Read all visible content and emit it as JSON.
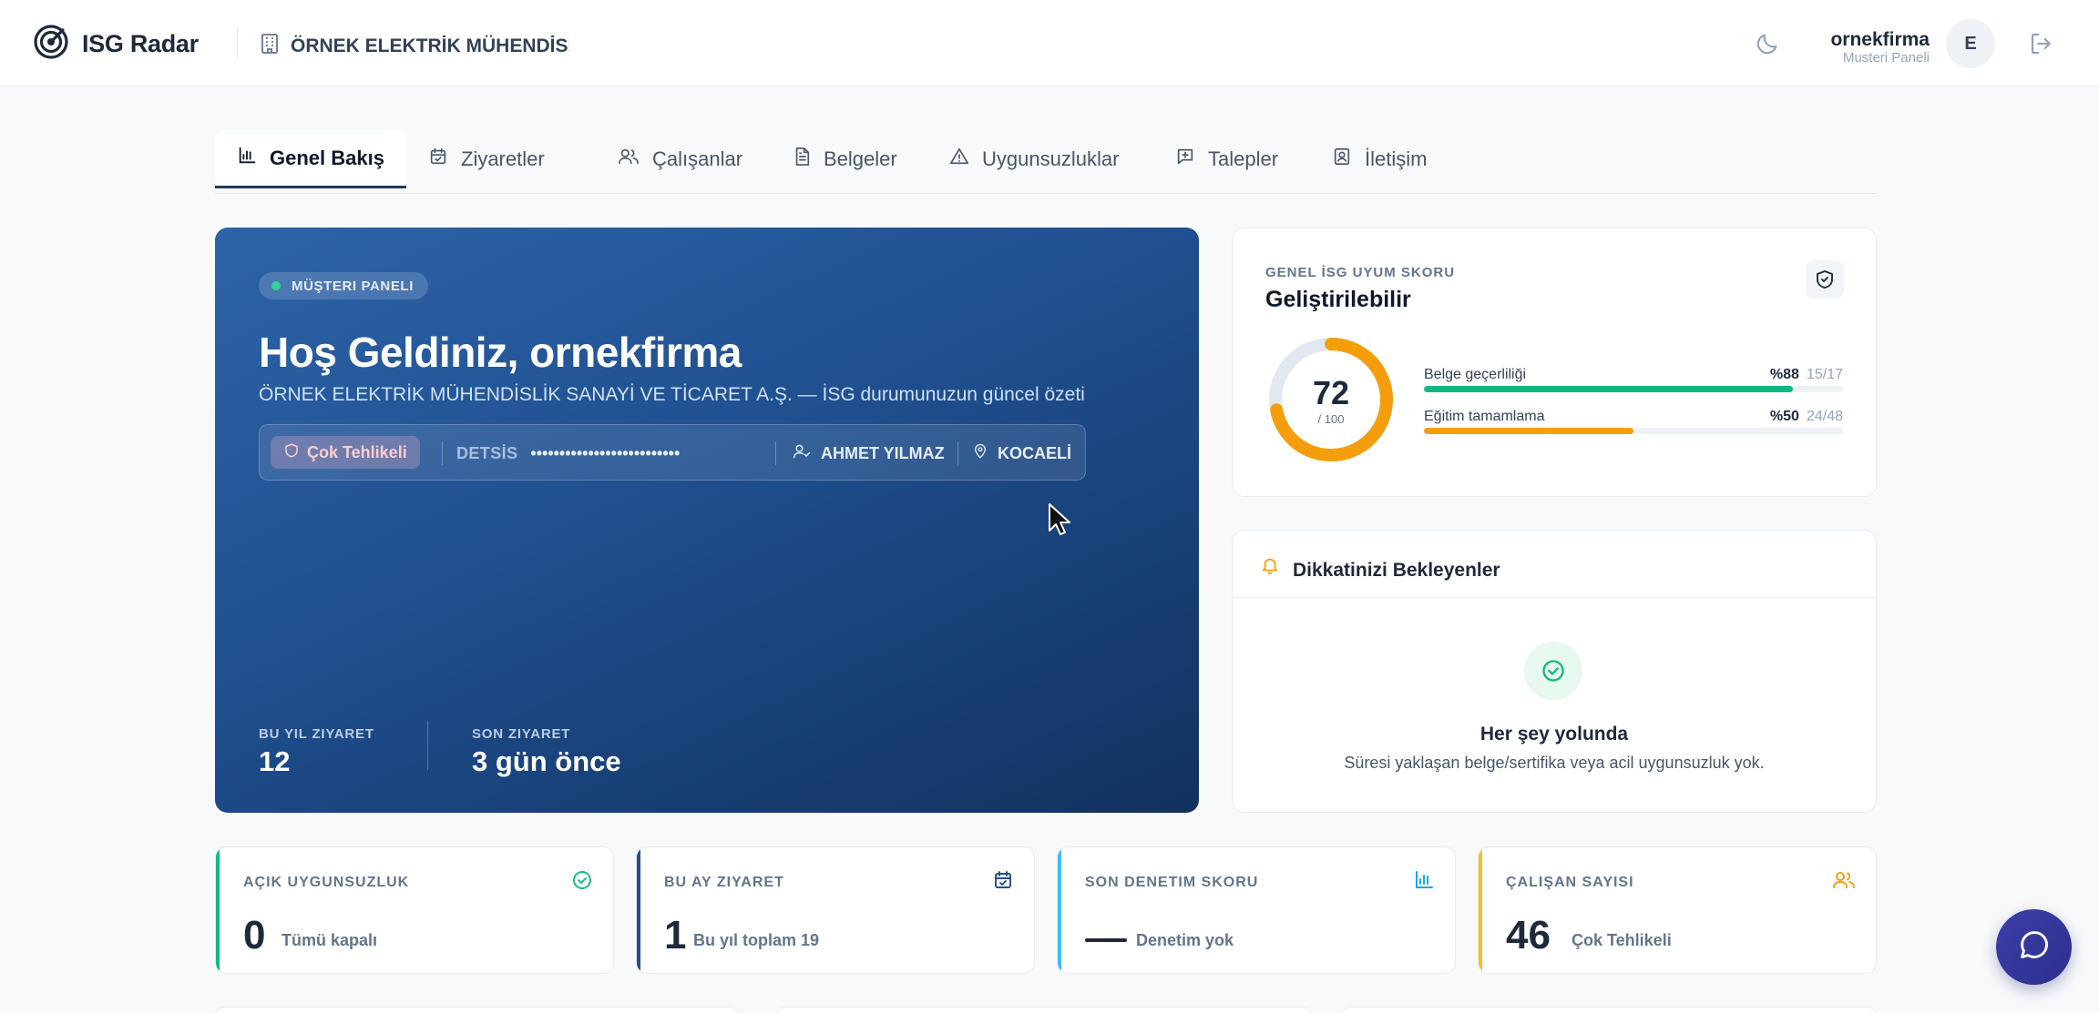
{
  "header": {
    "app_name": "ISG Radar",
    "company": "ÖRNEK ELEKTRİK MÜHENDİSLİK SANAYİ VE TİCARET A.Ş.",
    "user_name": "ornekfirma",
    "user_role": "Musteri Paneli",
    "avatar_initial": "E"
  },
  "tabs": [
    {
      "label": "Genel Bakış",
      "icon": "bar-chart-icon",
      "active": true
    },
    {
      "label": "Ziyaretler",
      "icon": "calendar-check-icon"
    },
    {
      "label": "Çalışanlar",
      "icon": "users-icon"
    },
    {
      "label": "Belgeler",
      "icon": "document-icon"
    },
    {
      "label": "Uygunsuzluklar",
      "icon": "warning-icon"
    },
    {
      "label": "Talepler",
      "icon": "message-plus-icon"
    },
    {
      "label": "İletişim",
      "icon": "contact-icon"
    }
  ],
  "hero": {
    "badge": "MÜŞTERI PANELI",
    "title": "Hoş Geldiniz, ornekfirma",
    "subtitle": "ÖRNEK ELEKTRİK MÜHENDİSLİK SANAYİ VE TİCARET A.Ş. — İSG durumunuzun güncel özeti",
    "danger_class": "Çok Tehlikeli",
    "detsis_label": "DETSİS",
    "detsis_value": "••••••••••••••••••••••••••",
    "expert": "AHMET YILMAZ",
    "city": "KOCAELİ",
    "stats": [
      {
        "label": "BU YIL ZIYARET",
        "value": "12"
      },
      {
        "label": "SON ZIYARET",
        "value": "3 gün önce"
      }
    ]
  },
  "score": {
    "label": "GENEL İSG UYUM SKORU",
    "title": "Geliştirilebilir",
    "value": 72,
    "max_label": "/ 100",
    "bars": [
      {
        "label": "Belge geçerliliği",
        "percent_label": "%88",
        "count": "15/17",
        "fraction": 0.88,
        "color": "#10b981"
      },
      {
        "label": "Eğitim tamamlama",
        "percent_label": "%50",
        "count": "24/48",
        "fraction": 0.5,
        "color": "#f59e0b"
      }
    ]
  },
  "attention": {
    "title": "Dikkatinizi Bekleyenler",
    "ok_title": "Her şey yolunda",
    "ok_desc": "Süresi yaklaşan belge/sertifika veya acil uygunsuzluk yok."
  },
  "kpis": [
    {
      "label": "AÇIK UYGUNSUZLUK",
      "value": "0",
      "sub": "Tümü kapalı",
      "color": "#10b981",
      "icon": "check-circle-icon"
    },
    {
      "label": "BU AY ZIYARET",
      "value": "1",
      "sub": "Bu yıl toplam 19",
      "color": "#1e4f8f",
      "icon": "calendar-check-icon"
    },
    {
      "label": "SON DENETIM SKORU",
      "value": "",
      "sub": "Denetim yok",
      "color": "#38bdf8",
      "icon": "bar-chart-icon"
    },
    {
      "label": "ÇALIŞAN SAYISI",
      "value": "46",
      "sub": "Çok Tehlikeli",
      "color": "#fbbf24",
      "icon": "users-icon"
    }
  ],
  "colors": {
    "primary": "#1e4f8f",
    "success": "#10b981",
    "warning": "#f59e0b",
    "chat": "#3b3fa8"
  }
}
